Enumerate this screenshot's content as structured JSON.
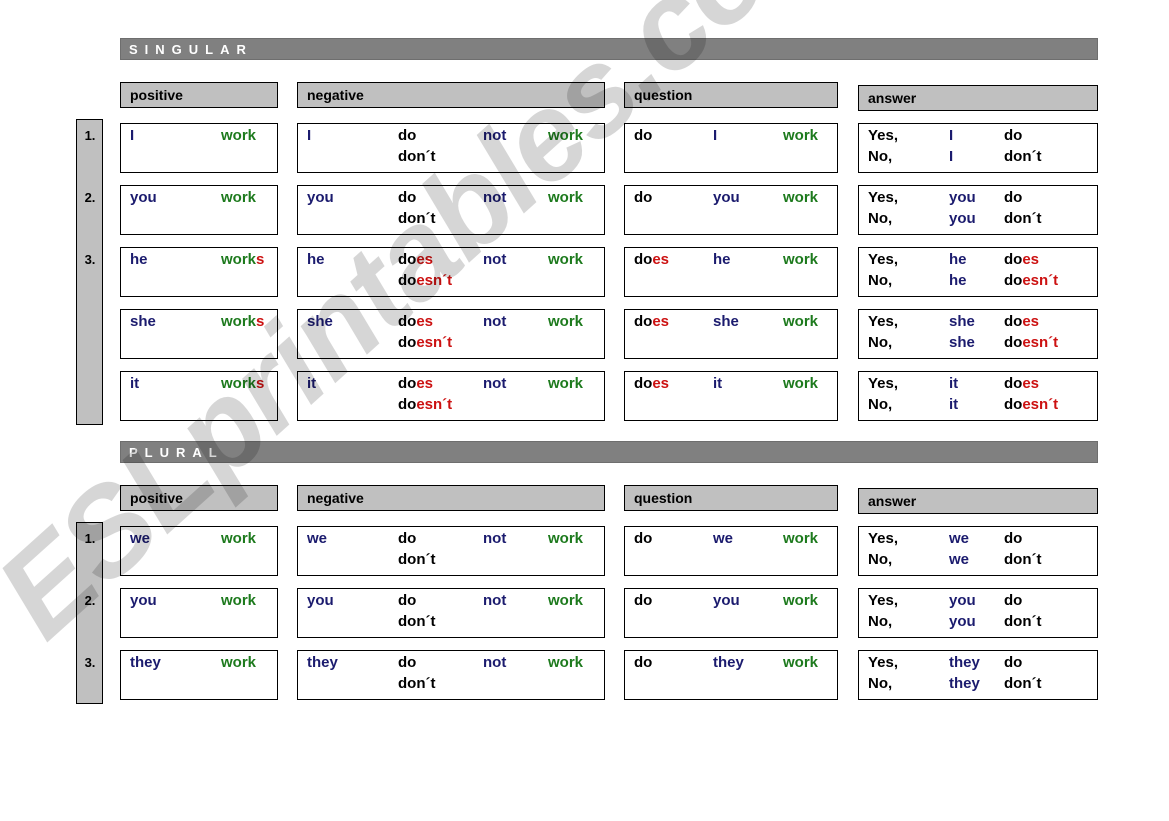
{
  "watermark": {
    "text": "ESLprintables.com"
  },
  "sections": [
    {
      "id": "singular",
      "band_label": "SINGULAR",
      "headers": [
        {
          "key": "positive",
          "label": "positive"
        },
        {
          "key": "negative",
          "label": "negative"
        },
        {
          "key": "question",
          "label": "question"
        },
        {
          "key": "answer",
          "label": "answer"
        }
      ],
      "ordinals": [
        "1.",
        "2.",
        "3."
      ],
      "rows": [
        {
          "ordinal": "1.",
          "positive": {
            "subject": "I",
            "verb": "work",
            "verb_suffix": ""
          },
          "negative": {
            "subject": "I",
            "aux": "do",
            "aux_suffix": "",
            "contraction": "don´t",
            "contraction_suffix": "",
            "not": "not",
            "verb": "work"
          },
          "question": {
            "aux": "do",
            "aux_suffix": "",
            "subject": "I",
            "verb": "work"
          },
          "answer": {
            "yes": "Yes,",
            "no": "No,",
            "subject": "I",
            "aux_yes": "do",
            "aux_yes_suffix": "",
            "aux_no": "don´t",
            "aux_no_suffix": ""
          }
        },
        {
          "ordinal": "2.",
          "positive": {
            "subject": "you",
            "verb": "work",
            "verb_suffix": ""
          },
          "negative": {
            "subject": "you",
            "aux": "do",
            "aux_suffix": "",
            "contraction": "don´t",
            "contraction_suffix": "",
            "not": "not",
            "verb": "work"
          },
          "question": {
            "aux": "do",
            "aux_suffix": "",
            "subject": "you",
            "verb": "work"
          },
          "answer": {
            "yes": "Yes,",
            "no": "No,",
            "subject": "you",
            "aux_yes": "do",
            "aux_yes_suffix": "",
            "aux_no": "don´t",
            "aux_no_suffix": ""
          }
        },
        {
          "ordinal": "3.",
          "positive": {
            "subject": "he",
            "verb": "work",
            "verb_suffix": "s"
          },
          "negative": {
            "subject": "he",
            "aux": "do",
            "aux_suffix": "es",
            "contraction": "do",
            "contraction_suffix": "esn´t",
            "not": "not",
            "verb": "work"
          },
          "question": {
            "aux": "do",
            "aux_suffix": "es",
            "subject": "he",
            "verb": "work"
          },
          "answer": {
            "yes": "Yes,",
            "no": "No,",
            "subject": "he",
            "aux_yes": "do",
            "aux_yes_suffix": "es",
            "aux_no": "do",
            "aux_no_suffix": "esn´t"
          }
        },
        {
          "ordinal": "",
          "positive": {
            "subject": "she",
            "verb": "work",
            "verb_suffix": "s"
          },
          "negative": {
            "subject": "she",
            "aux": "do",
            "aux_suffix": "es",
            "contraction": "do",
            "contraction_suffix": "esn´t",
            "not": "not",
            "verb": "work"
          },
          "question": {
            "aux": "do",
            "aux_suffix": "es",
            "subject": "she",
            "verb": "work"
          },
          "answer": {
            "yes": "Yes,",
            "no": "No,",
            "subject": "she",
            "aux_yes": "do",
            "aux_yes_suffix": "es",
            "aux_no": "do",
            "aux_no_suffix": "esn´t"
          }
        },
        {
          "ordinal": "",
          "positive": {
            "subject": "it",
            "verb": "work",
            "verb_suffix": "s"
          },
          "negative": {
            "subject": "it",
            "aux": "do",
            "aux_suffix": "es",
            "contraction": "do",
            "contraction_suffix": "esn´t",
            "not": "not",
            "verb": "work"
          },
          "question": {
            "aux": "do",
            "aux_suffix": "es",
            "subject": "it",
            "verb": "work"
          },
          "answer": {
            "yes": "Yes,",
            "no": "No,",
            "subject": "it",
            "aux_yes": "do",
            "aux_yes_suffix": "es",
            "aux_no": "do",
            "aux_no_suffix": "esn´t"
          }
        }
      ]
    },
    {
      "id": "plural",
      "band_label": "PLURAL",
      "headers": [
        {
          "key": "positive",
          "label": "positive"
        },
        {
          "key": "negative",
          "label": "negative"
        },
        {
          "key": "question",
          "label": "question"
        },
        {
          "key": "answer",
          "label": "answer"
        }
      ],
      "ordinals": [
        "1.",
        "2.",
        "3."
      ],
      "rows": [
        {
          "ordinal": "1.",
          "positive": {
            "subject": "we",
            "verb": "work",
            "verb_suffix": ""
          },
          "negative": {
            "subject": "we",
            "aux": "do",
            "aux_suffix": "",
            "contraction": "don´t",
            "contraction_suffix": "",
            "not": "not",
            "verb": "work"
          },
          "question": {
            "aux": "do",
            "aux_suffix": "",
            "subject": "we",
            "verb": "work"
          },
          "answer": {
            "yes": "Yes,",
            "no": "No,",
            "subject": "we",
            "aux_yes": "do",
            "aux_yes_suffix": "",
            "aux_no": "don´t",
            "aux_no_suffix": ""
          }
        },
        {
          "ordinal": "2.",
          "positive": {
            "subject": "you",
            "verb": "work",
            "verb_suffix": ""
          },
          "negative": {
            "subject": "you",
            "aux": "do",
            "aux_suffix": "",
            "contraction": "don´t",
            "contraction_suffix": "",
            "not": "not",
            "verb": "work"
          },
          "question": {
            "aux": "do",
            "aux_suffix": "",
            "subject": "you",
            "verb": "work"
          },
          "answer": {
            "yes": "Yes,",
            "no": "No,",
            "subject": "you",
            "aux_yes": "do",
            "aux_yes_suffix": "",
            "aux_no": "don´t",
            "aux_no_suffix": ""
          }
        },
        {
          "ordinal": "3.",
          "positive": {
            "subject": "they",
            "verb": "work",
            "verb_suffix": ""
          },
          "negative": {
            "subject": "they",
            "aux": "do",
            "aux_suffix": "",
            "contraction": "don´t",
            "contraction_suffix": "",
            "not": "not",
            "verb": "work"
          },
          "question": {
            "aux": "do",
            "aux_suffix": "",
            "subject": "they",
            "verb": "work"
          },
          "answer": {
            "yes": "Yes,",
            "no": "No,",
            "subject": "they",
            "aux_yes": "do",
            "aux_yes_suffix": "",
            "aux_no": "don´t",
            "aux_no_suffix": ""
          }
        }
      ]
    }
  ],
  "colors": {
    "pronoun": "#1b1b6e",
    "verb": "#1d7a1d",
    "suffix": "#cc1111",
    "auxiliary": "#000000",
    "negation": "#1b1b6e",
    "band_bg": "#808080",
    "header_bg": "#c0c0c0"
  }
}
